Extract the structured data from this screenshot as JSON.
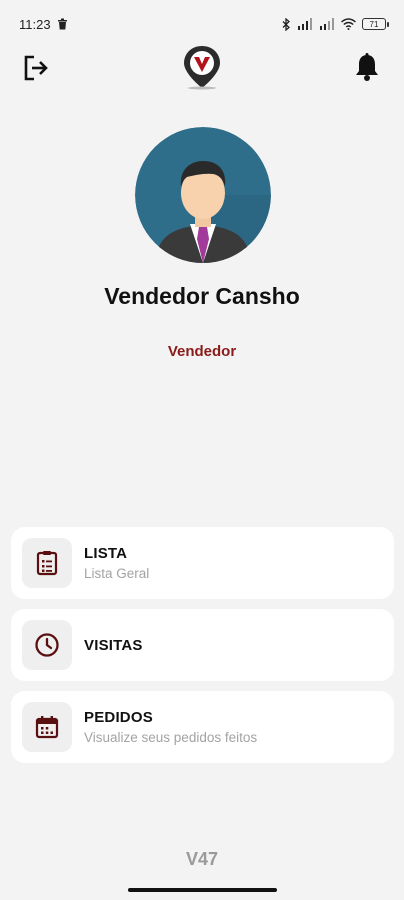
{
  "status_bar": {
    "time": "11:23",
    "battery": "71",
    "icons": [
      "trash-icon",
      "bluetooth-icon",
      "signal-icon",
      "signal-icon",
      "wifi-icon",
      "battery-icon"
    ]
  },
  "app_bar": {
    "left_icon": "logout-icon",
    "center_icon": "brand-logo",
    "right_icon": "bell-icon"
  },
  "profile": {
    "name": "Vendedor Cansho",
    "role": "Vendedor"
  },
  "menu": [
    {
      "title": "LISTA",
      "subtitle": "Lista Geral",
      "icon": "clipboard-list-icon"
    },
    {
      "title": "VISITAS",
      "subtitle": "",
      "icon": "clock-icon"
    },
    {
      "title": "PEDIDOS",
      "subtitle": "Visualize seus pedidos feitos",
      "icon": "calendar-icon"
    }
  ],
  "version": "V47",
  "colors": {
    "accent": "#8b1a1a",
    "icon_dark": "#5a1010",
    "background": "#f3f3f3",
    "card": "#ffffff"
  }
}
